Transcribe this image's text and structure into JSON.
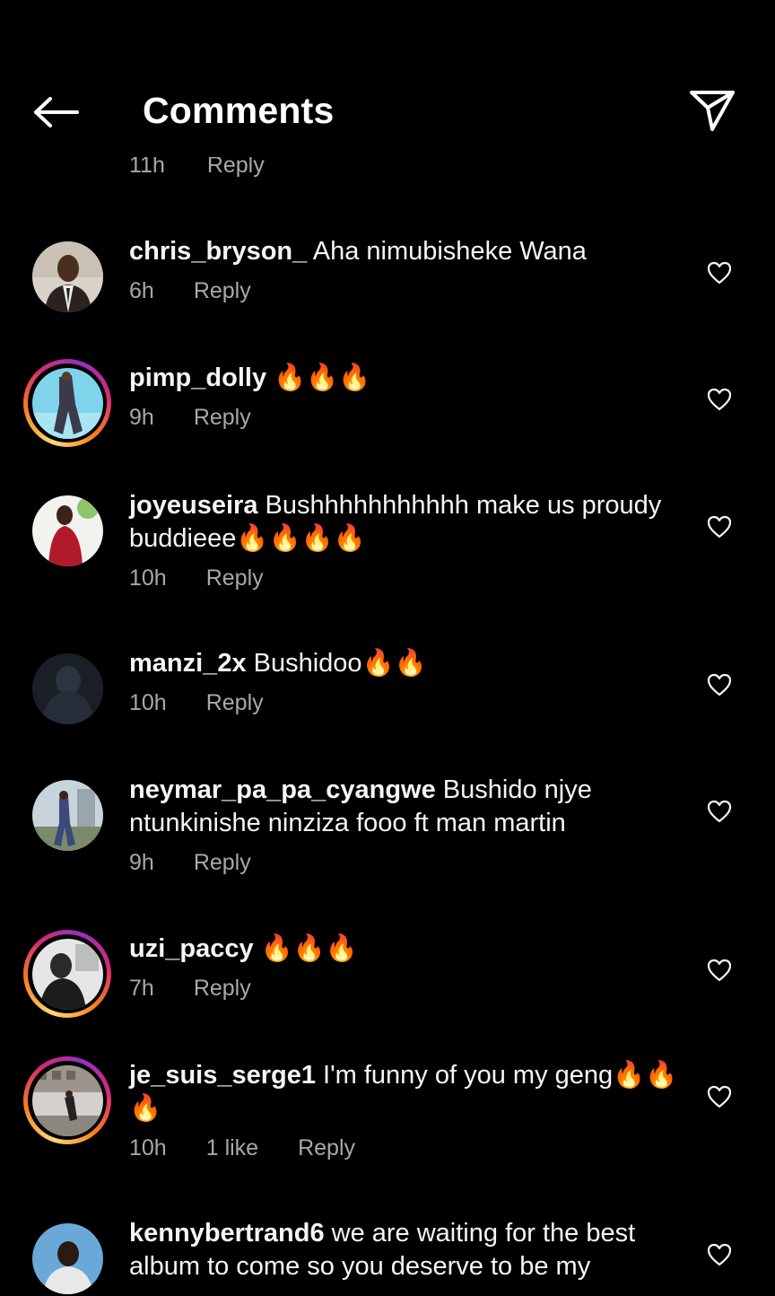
{
  "header": {
    "title": "Comments",
    "back_icon": "arrow-left-icon",
    "share_icon": "paper-plane-icon"
  },
  "partial_row": {
    "time": "11h",
    "reply": "Reply"
  },
  "comments": [
    {
      "username": "chris_bryson_",
      "text": " Aha nimubisheke Wana",
      "time": "6h",
      "likes": "",
      "reply": "Reply",
      "story_ring": false
    },
    {
      "username": "pimp_dolly",
      "text": " 🔥🔥🔥",
      "time": "9h",
      "likes": "",
      "reply": "Reply",
      "story_ring": true
    },
    {
      "username": "joyeuseira",
      "text": " Bushhhhhhhhhhh make us proudy buddieee🔥🔥🔥🔥",
      "time": "10h",
      "likes": "",
      "reply": "Reply",
      "story_ring": false
    },
    {
      "username": "manzi_2x",
      "text": " Bushidoo🔥🔥",
      "time": "10h",
      "likes": "",
      "reply": "Reply",
      "story_ring": false
    },
    {
      "username": "neymar_pa_pa_cyangwe",
      "text": " Bushido njye ntunkinishe ninziza fooo ft man martin",
      "time": "9h",
      "likes": "",
      "reply": "Reply",
      "story_ring": false
    },
    {
      "username": "uzi_paccy",
      "text": " 🔥🔥🔥",
      "time": "7h",
      "likes": "",
      "reply": "Reply",
      "story_ring": true
    },
    {
      "username": "je_suis_serge1",
      "text": " I'm funny of you my geng🔥🔥🔥",
      "time": "10h",
      "likes": "1 like",
      "reply": "Reply",
      "story_ring": true
    },
    {
      "username": "kennybertrand6",
      "text": " we are waiting for the best album to come so you deserve to be my",
      "time": "",
      "likes": "",
      "reply": "",
      "story_ring": false
    }
  ],
  "colors": {
    "background": "#000000",
    "text_primary": "#f5f5f5",
    "text_secondary": "#a8a8a8",
    "story_ring": [
      "#feda75",
      "#fa7e1e",
      "#d62976",
      "#962fbf"
    ]
  }
}
